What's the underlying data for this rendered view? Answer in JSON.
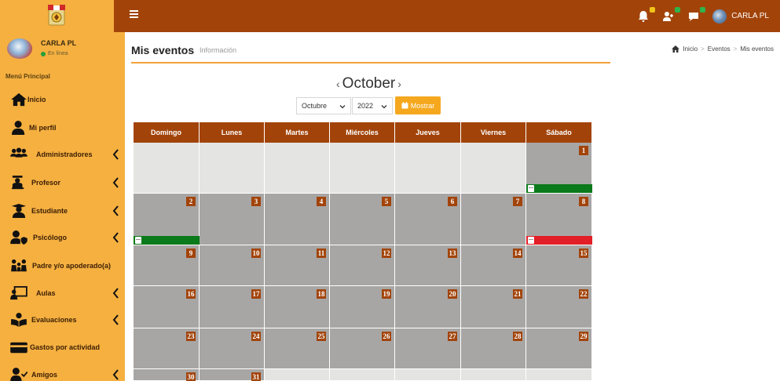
{
  "header": {
    "user_name": "CARLA PL",
    "colors": {
      "brand": "#a2440a",
      "accent": "#f5b040",
      "badge_yellow": "#f0c419",
      "badge_green": "#2fb34a",
      "badge_blue": "#2a8de0"
    }
  },
  "sidebar": {
    "user_name": "CARLA PL",
    "status": "En línea",
    "menu_header": "Menú Principal",
    "items": [
      {
        "label": "Inicio",
        "icon": "home-icon",
        "has_children": false
      },
      {
        "label": "Mi perfil",
        "icon": "user-icon",
        "has_children": false
      },
      {
        "label": "Administradores",
        "icon": "users-group-icon",
        "has_children": true
      },
      {
        "label": "Profesor",
        "icon": "teacher-icon",
        "has_children": true
      },
      {
        "label": "Estudiante",
        "icon": "graduate-icon",
        "has_children": true
      },
      {
        "label": "Psicólogo",
        "icon": "user-shield-icon",
        "has_children": true
      },
      {
        "label": "Padre y/o apoderado(a)",
        "icon": "family-icon",
        "has_children": false
      },
      {
        "label": "Aulas",
        "icon": "chalkboard-icon",
        "has_children": true
      },
      {
        "label": "Evaluaciones",
        "icon": "book-reader-icon",
        "has_children": true
      },
      {
        "label": "Gastos por actividad",
        "icon": "credit-card-icon",
        "has_children": false
      },
      {
        "label": "Amigos",
        "icon": "user-check-icon",
        "has_children": true
      }
    ]
  },
  "content": {
    "title": "Mis eventos",
    "subtitle": "Información",
    "breadcrumb": [
      "Inicio",
      "Eventos",
      "Mis eventos"
    ]
  },
  "calendar": {
    "month_title": "October",
    "prev_arrow": "‹",
    "next_arrow": "›",
    "month_select": "Octubre",
    "year_select": "2022",
    "show_button": "Mostrar",
    "weekdays": [
      "Domingo",
      "Lunes",
      "Martes",
      "Miércoles",
      "Jueves",
      "Viernes",
      "Sábado"
    ],
    "weeks": [
      [
        null,
        null,
        null,
        null,
        null,
        null,
        1
      ],
      [
        2,
        3,
        4,
        5,
        6,
        7,
        8
      ],
      [
        9,
        10,
        11,
        12,
        13,
        14,
        15
      ],
      [
        16,
        17,
        18,
        19,
        20,
        21,
        22
      ],
      [
        23,
        24,
        25,
        26,
        27,
        28,
        29
      ],
      [
        30,
        31,
        null,
        null,
        null,
        null,
        null
      ]
    ],
    "events": [
      {
        "day": 1,
        "color": "#0b7a1a"
      },
      {
        "day": 2,
        "color": "#0b7a1a"
      },
      {
        "day": 8,
        "color": "#e21e26"
      }
    ]
  }
}
